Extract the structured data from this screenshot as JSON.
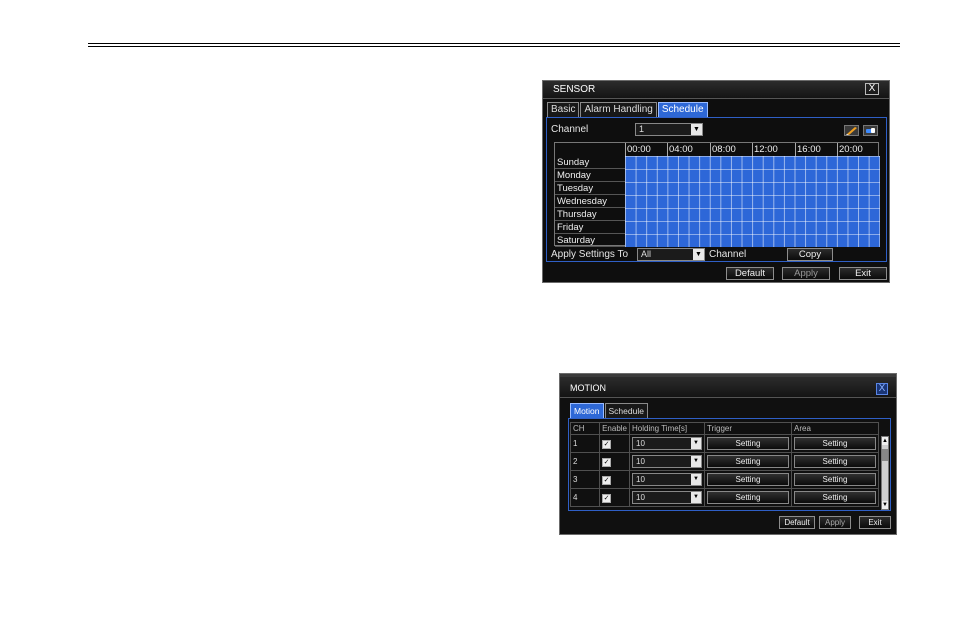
{
  "sensor": {
    "title": "SENSOR",
    "close": "X",
    "tabs": [
      "Basic",
      "Alarm Handling",
      "Schedule"
    ],
    "channel_label": "Channel",
    "channel_value": "1",
    "hours": [
      "00:00",
      "04:00",
      "08:00",
      "12:00",
      "16:00",
      "20:00"
    ],
    "days": [
      "Sunday",
      "Monday",
      "Tuesday",
      "Wednesday",
      "Thursday",
      "Friday",
      "Saturday"
    ],
    "apply_settings_to": "Apply Settings To",
    "apply_value": "All",
    "channel_word": "Channel",
    "copy": "Copy",
    "default": "Default",
    "apply": "Apply",
    "exit": "Exit",
    "icons": [
      "edit-pencil-icon",
      "erase-icon"
    ],
    "colors": {
      "schedule_fill": "#2d67d8",
      "tab_active": "#2e68d6"
    }
  },
  "motion": {
    "title": "MOTION",
    "close": "X",
    "tabs": [
      "Motion",
      "Schedule"
    ],
    "columns": [
      "CH",
      "Enable",
      "Holding Time[s]",
      "Trigger",
      "Area"
    ],
    "rows": [
      {
        "ch": "1",
        "enable": "✓",
        "holding": "10",
        "trigger": "Setting",
        "area": "Setting"
      },
      {
        "ch": "2",
        "enable": "✓",
        "holding": "10",
        "trigger": "Setting",
        "area": "Setting"
      },
      {
        "ch": "3",
        "enable": "✓",
        "holding": "10",
        "trigger": "Setting",
        "area": "Setting"
      },
      {
        "ch": "4",
        "enable": "✓",
        "holding": "10",
        "trigger": "Setting",
        "area": "Setting"
      }
    ],
    "default": "Default",
    "apply": "Apply",
    "exit": "Exit"
  }
}
